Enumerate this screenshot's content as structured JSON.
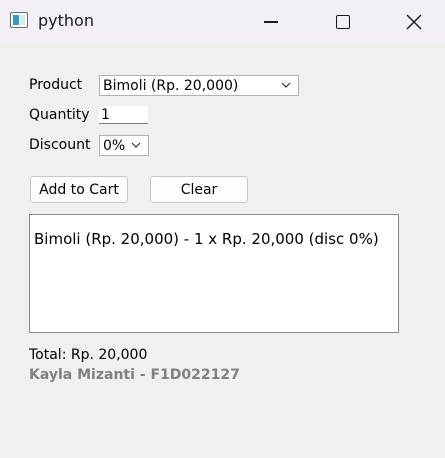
{
  "window": {
    "title": "python",
    "icon": "python-app-icon"
  },
  "form": {
    "product_label": "Product",
    "product_value": "Bimoli (Rp. 20,000)",
    "quantity_label": "Quantity",
    "quantity_value": "1",
    "discount_label": "Discount",
    "discount_value": "0%"
  },
  "buttons": {
    "add_to_cart": "Add to Cart",
    "clear": "Clear"
  },
  "cart": {
    "items": [
      "Bimoli (Rp. 20,000) - 1 x Rp. 20,000 (disc 0%)"
    ]
  },
  "summary": {
    "total": "Total: Rp. 20,000",
    "credit": "Kayla Mizanti - F1D022127"
  }
}
